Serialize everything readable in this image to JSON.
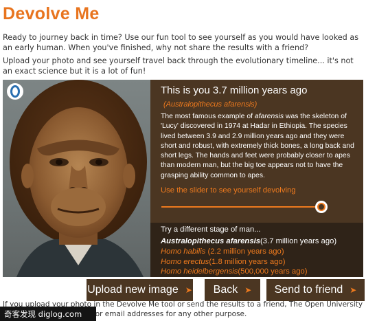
{
  "page": {
    "title": "Devolve Me",
    "intro_1": "Ready to journey back in time? Use our fun tool to see yourself as you would have looked as an early human. When you've finished, why not share the results with a friend?",
    "intro_2": "Upload your photo and see yourself travel back through the evolutionary timeline... it's not an exact science but it is a lot of fun!"
  },
  "result": {
    "title": "This is you 3.7 million years ago",
    "species": "(Australopithecus afarensis)",
    "desc_1": "The most famous example of ",
    "desc_em": "afarensis",
    "desc_2": " was the skeleton of 'Lucy' discovered in 1974 at Hadar in Ethiopia. The species lived between 3.9 and 2.9 million years ago and they were short and robust, with extremely thick bones, a long back and short legs. The hands and feet were probably closer to apes than modern man, but the big toe appears not to have the grasping ability common to apes.",
    "slider_label": "Use the slider to see yourself devolving",
    "slider_position": 0.97
  },
  "stages": {
    "heading": "Try a different stage of man...",
    "items": [
      {
        "name": "Australopithecus afarensis",
        "age": "(3.7 million years ago)",
        "active": true
      },
      {
        "name": "Homo habilis",
        "age": " (2.2 million years ago)",
        "active": false
      },
      {
        "name": "Homo erectus",
        "age": "(1.8 million years ago)",
        "active": false
      },
      {
        "name": "Homo heidelbergensis",
        "age": "(500,000 years ago)",
        "active": false
      }
    ]
  },
  "buttons": {
    "upload": "Upload new image",
    "back": "Back",
    "send": "Send to friend",
    "arrow": "➤"
  },
  "footer": {
    "note": "If you upload your photo in the Devolve Me tool or send the results to a friend, The Open University will not use these photos or email addresses for any other purpose."
  },
  "watermark": {
    "text": "奇客发现 diglog.com"
  },
  "colors": {
    "accent": "#ee7a1e",
    "title": "#e8741e",
    "panel_brown": "#4b3622",
    "panel_dark": "#2f2318"
  }
}
